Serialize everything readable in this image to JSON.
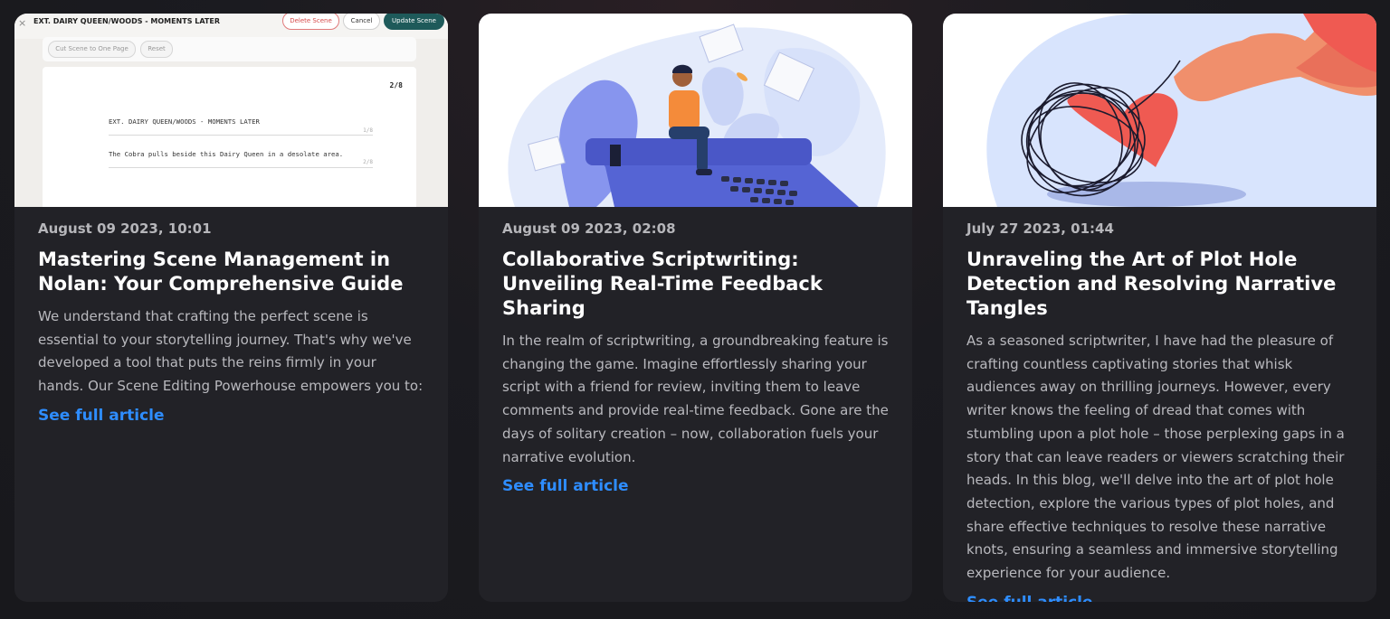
{
  "articles": [
    {
      "date": "August 09 2023, 10:01",
      "title": "Mastering Scene Management in Nolan: Your Comprehensive Guide",
      "excerpt": "We understand that crafting the perfect scene is essential to your storytelling journey. That's why we've developed a tool that puts the reins firmly in your hands. Our Scene Editing Powerhouse empowers you to:",
      "link": "See full article",
      "thumbnail": {
        "scene_heading": "EXT. DAIRY QUEEN/WOODS - MOMENTS LATER",
        "close": "×",
        "delete_label": "Delete Scene",
        "cancel_label": "Cancel",
        "update_label": "Update Scene",
        "cut_label": "Cut Scene to One Page",
        "reset_label": "Reset",
        "page_number": "2/8",
        "line1": "EXT. DAIRY QUEEN/WOODS - MOMENTS LATER",
        "line1_count": "1/8",
        "line2": "The Cobra pulls beside this Dairy Queen in a desolate area.",
        "line2_count": "2/8"
      }
    },
    {
      "date": "August 09 2023, 02:08",
      "title": "Collaborative Scriptwriting: Unveiling Real-Time Feedback Sharing",
      "excerpt": "In the realm of scriptwriting, a groundbreaking feature is changing the game. Imagine effortlessly sharing your script with a friend for review, inviting them to leave comments and provide real-time feedback. Gone are the days of solitary creation – now, collaboration fuels your narrative evolution.",
      "link": "See full article"
    },
    {
      "date": "July 27 2023, 01:44",
      "title": "Unraveling the Art of Plot Hole Detection and Resolving Narrative Tangles",
      "excerpt": "As a seasoned scriptwriter, I have had the pleasure of crafting countless captivating stories that whisk audiences away on thrilling journeys. However, every writer knows the feeling of dread that comes with stumbling upon a plot hole – those perplexing gaps in a story that can leave readers or viewers scratching their heads. In this blog, we'll delve into the art of plot hole detection, explore the various types of plot holes, and share effective techniques to resolve these narrative knots, ensuring a seamless and immersive storytelling experience for your audience.",
      "link": "See full article"
    }
  ],
  "colors": {
    "card_bg": "#222227",
    "link": "#2e8dff",
    "accent_teal": "#1e5a5a"
  },
  "icons": [
    "close-icon",
    "typewriter-illustration",
    "tangled-heart-illustration"
  ]
}
